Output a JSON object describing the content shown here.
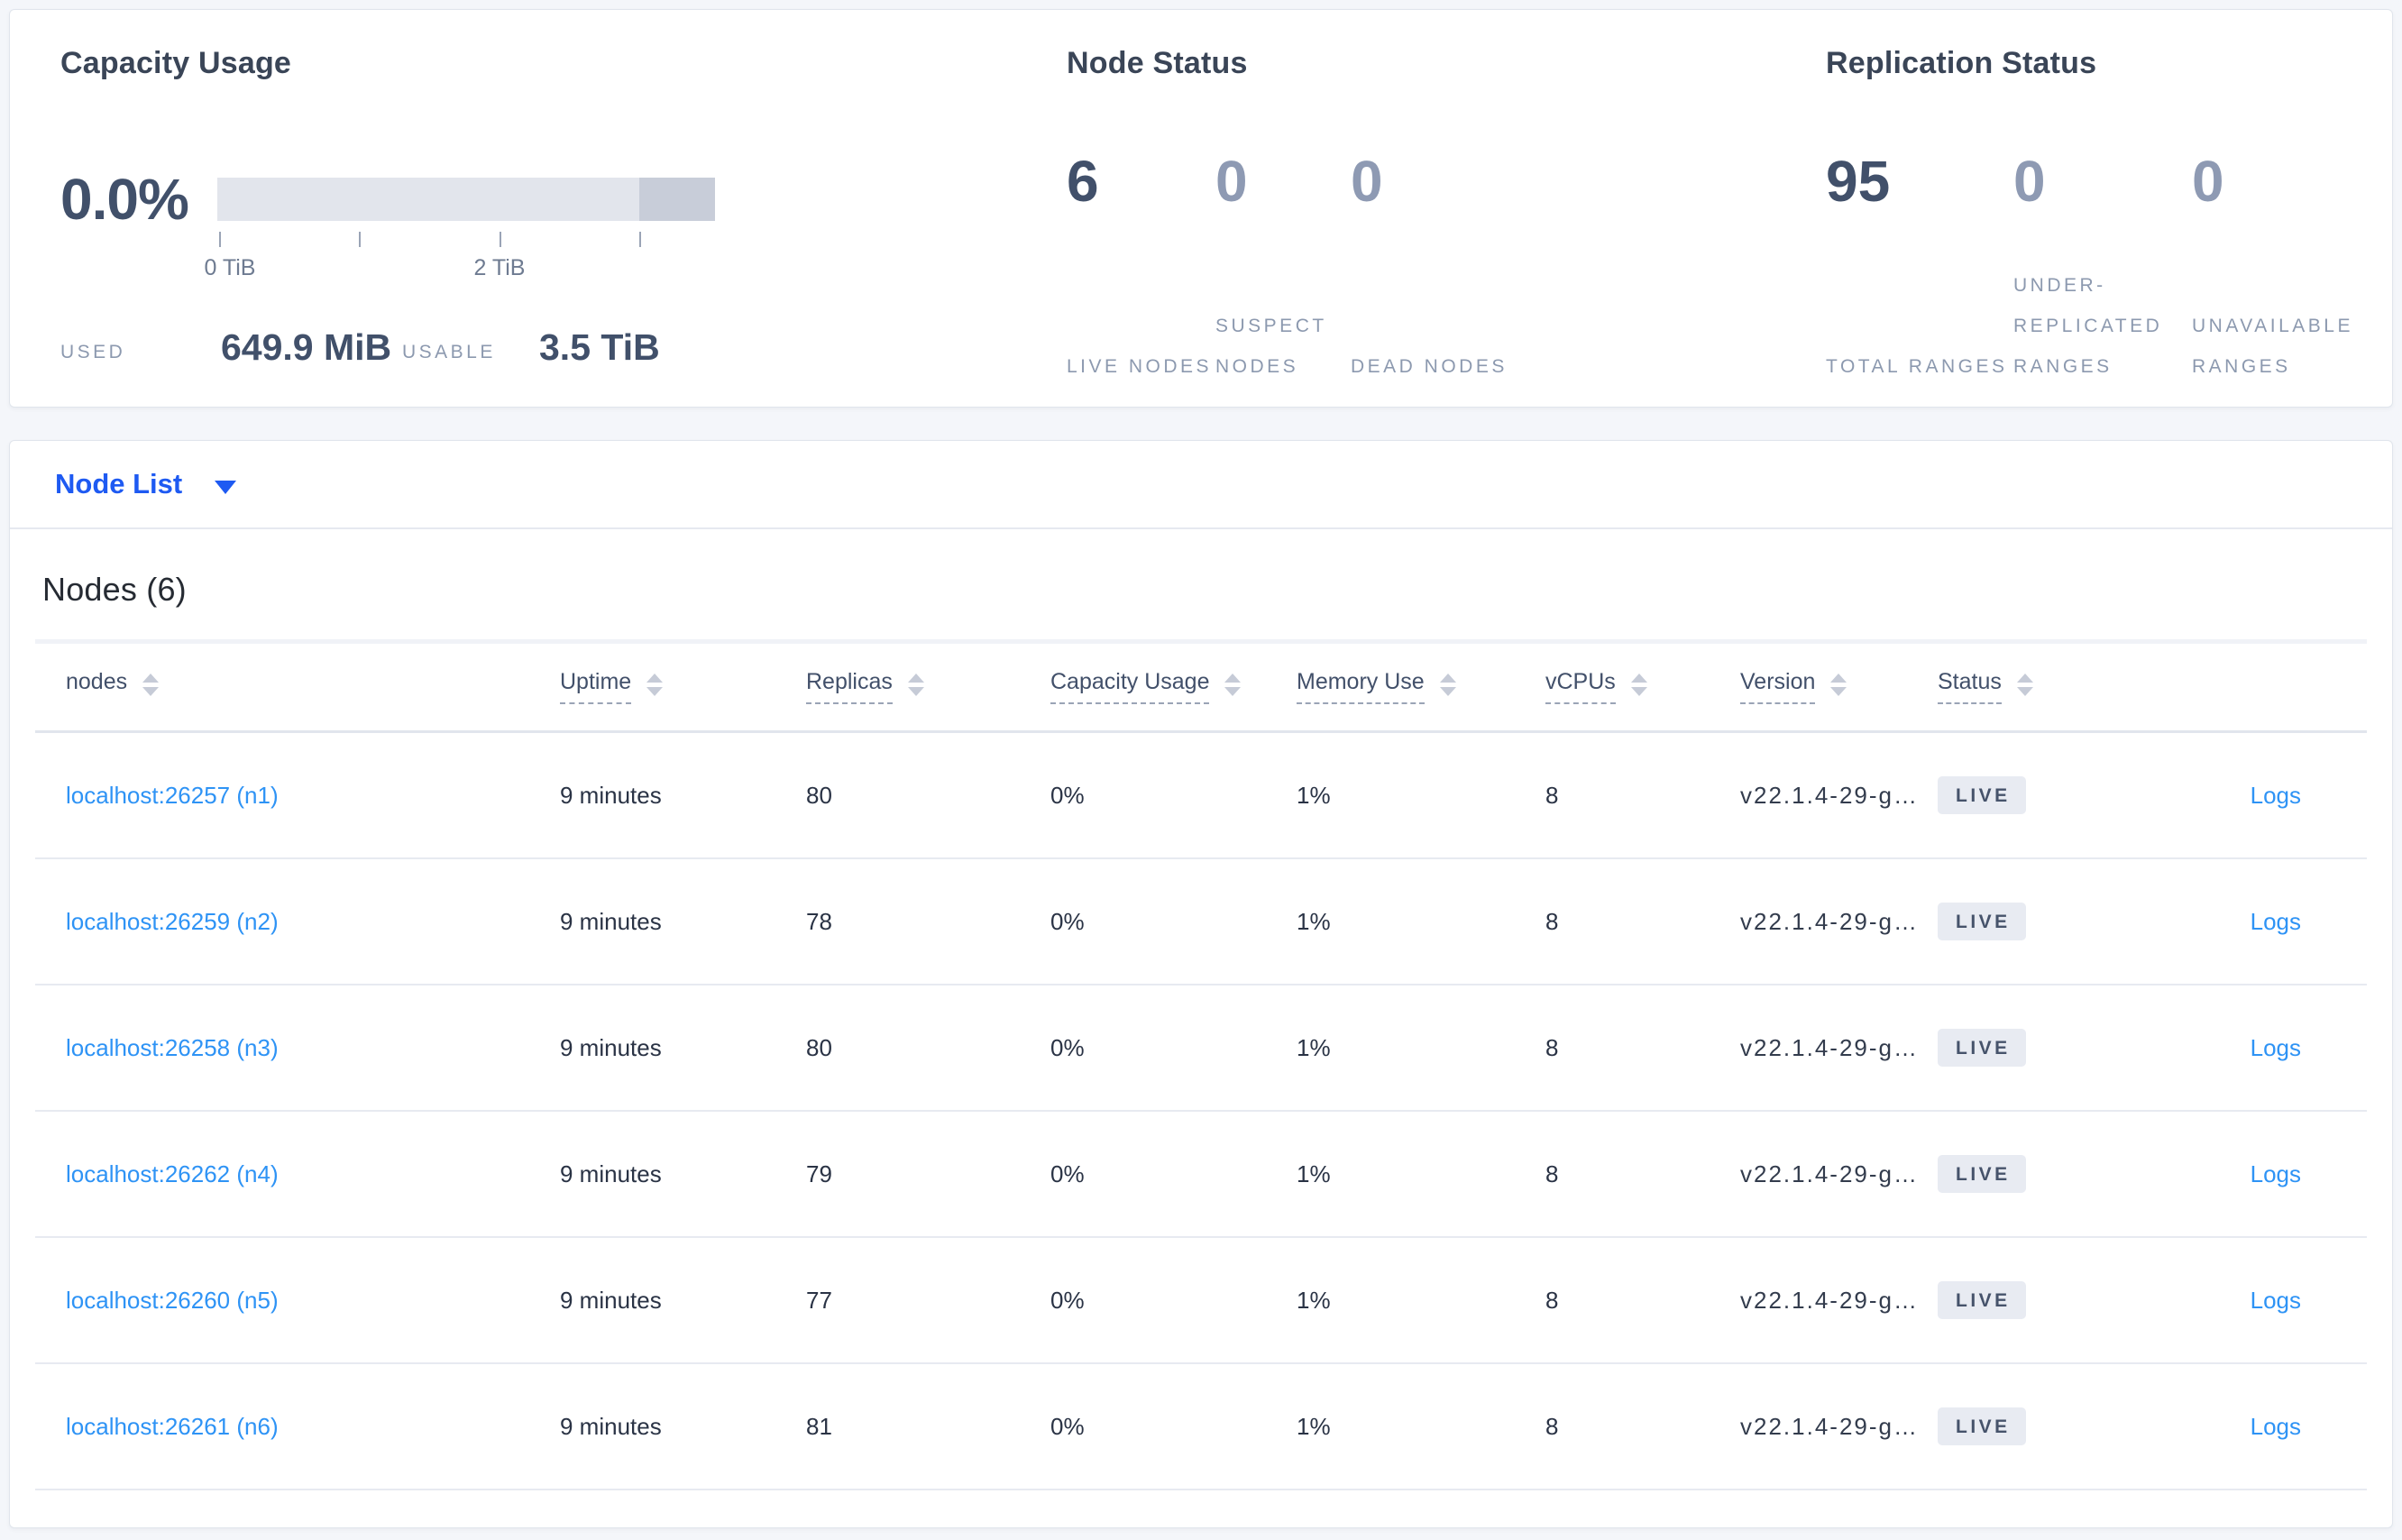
{
  "summary": {
    "capacity": {
      "title": "Capacity Usage",
      "percent_used": "0.0%",
      "tick_labels": [
        "0 TiB",
        "2 TiB"
      ],
      "used_label": "USED",
      "used_value": "649.9 MiB",
      "usable_label": "USABLE",
      "usable_value": "3.5 TiB"
    },
    "node_status": {
      "title": "Node Status",
      "stats": [
        {
          "value": "6",
          "label": "LIVE NODES"
        },
        {
          "value": "0",
          "label": "SUSPECT NODES"
        },
        {
          "value": "0",
          "label": "DEAD NODES"
        }
      ]
    },
    "replication": {
      "title": "Replication Status",
      "stats": [
        {
          "value": "95",
          "label": "TOTAL RANGES"
        },
        {
          "value": "0",
          "label": "UNDER-REPLICATED RANGES"
        },
        {
          "value": "0",
          "label": "UNAVAILABLE RANGES"
        }
      ]
    }
  },
  "view_selector": {
    "label": "Node List"
  },
  "table": {
    "title": "Nodes (6)",
    "columns": [
      {
        "label": "nodes"
      },
      {
        "label": "Uptime"
      },
      {
        "label": "Replicas"
      },
      {
        "label": "Capacity Usage"
      },
      {
        "label": "Memory Use"
      },
      {
        "label": "vCPUs"
      },
      {
        "label": "Version"
      },
      {
        "label": "Status"
      }
    ],
    "rows": [
      {
        "node": "localhost:26257 (n1)",
        "uptime": "9 minutes",
        "replicas": "80",
        "capacity": "0%",
        "memory": "1%",
        "vcpus": "8",
        "version": "v22.1.4-29-g…",
        "status": "LIVE",
        "logs": "Logs"
      },
      {
        "node": "localhost:26259 (n2)",
        "uptime": "9 minutes",
        "replicas": "78",
        "capacity": "0%",
        "memory": "1%",
        "vcpus": "8",
        "version": "v22.1.4-29-g…",
        "status": "LIVE",
        "logs": "Logs"
      },
      {
        "node": "localhost:26258 (n3)",
        "uptime": "9 minutes",
        "replicas": "80",
        "capacity": "0%",
        "memory": "1%",
        "vcpus": "8",
        "version": "v22.1.4-29-g…",
        "status": "LIVE",
        "logs": "Logs"
      },
      {
        "node": "localhost:26262 (n4)",
        "uptime": "9 minutes",
        "replicas": "79",
        "capacity": "0%",
        "memory": "1%",
        "vcpus": "8",
        "version": "v22.1.4-29-g…",
        "status": "LIVE",
        "logs": "Logs"
      },
      {
        "node": "localhost:26260 (n5)",
        "uptime": "9 minutes",
        "replicas": "77",
        "capacity": "0%",
        "memory": "1%",
        "vcpus": "8",
        "version": "v22.1.4-29-g…",
        "status": "LIVE",
        "logs": "Logs"
      },
      {
        "node": "localhost:26261 (n6)",
        "uptime": "9 minutes",
        "replicas": "81",
        "capacity": "0%",
        "memory": "1%",
        "vcpus": "8",
        "version": "v22.1.4-29-g…",
        "status": "LIVE",
        "logs": "Logs"
      }
    ]
  },
  "colors": {
    "accent_blue": "#1E5AF2",
    "link_blue": "#2E93F5",
    "badge_bg": "#E8EBF2",
    "page_bg": "#F4F6FA"
  }
}
